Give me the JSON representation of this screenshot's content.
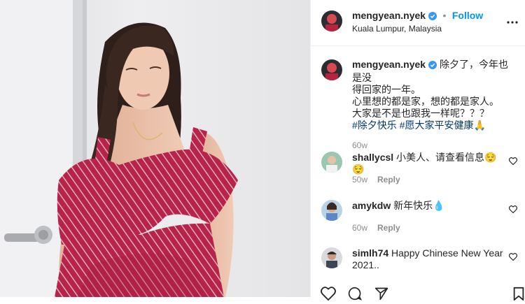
{
  "post": {
    "username": "mengyean.nyek",
    "follow_label": "Follow",
    "separator": "•",
    "location": "Kuala Lumpur, Malaysia",
    "caption_lines": [
      "除夕了，今年也是没",
      "得回家的一年。",
      "心里想的都是家，想的都是家人。",
      "大家是不是也跟我一样呢？？？"
    ],
    "hashtags": "#除夕快乐 #愿大家平安健康",
    "hashtag_emoji": "🙏",
    "time_ago": "60w"
  },
  "comments": [
    {
      "username": "shallycsl",
      "text": "小美人、请查看信息😌😌",
      "time": "50w",
      "reply_label": "Reply"
    },
    {
      "username": "amykdw",
      "text": "新年快乐💧",
      "time": "60w",
      "reply_label": "Reply"
    },
    {
      "username": "simlh74",
      "text": "Happy Chinese New Year 2021..",
      "time": "",
      "reply_label": ""
    }
  ],
  "colors": {
    "accent": "#0095f6",
    "verified": "#3897f0",
    "dress": "#b8234a"
  },
  "icons": [
    "verified-badge-icon",
    "more-options-icon",
    "heart-icon",
    "comment-icon",
    "share-icon",
    "save-icon"
  ]
}
